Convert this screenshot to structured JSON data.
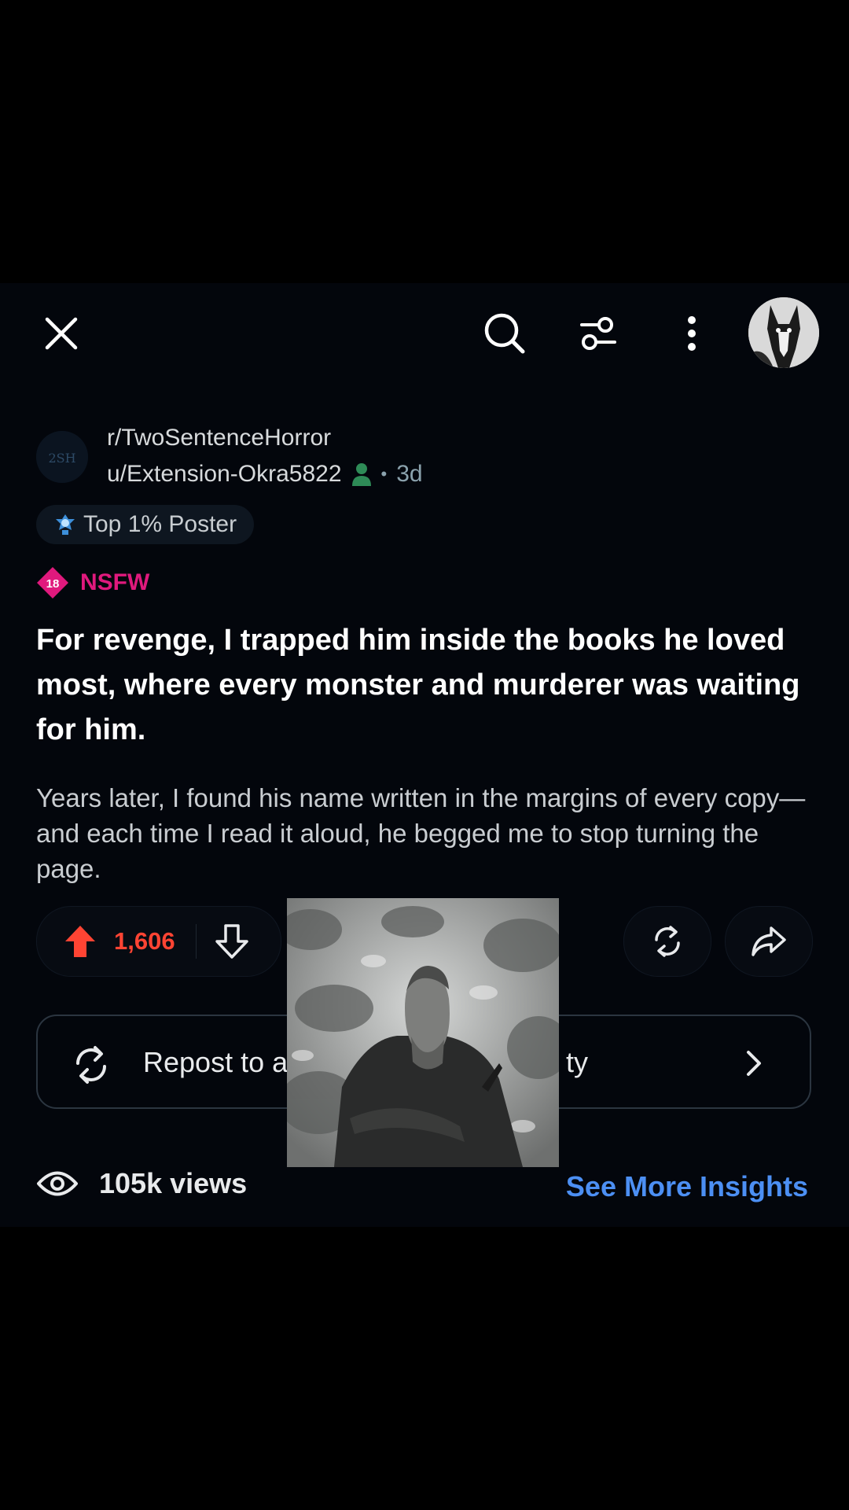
{
  "topbar": {
    "close_icon": "close-icon",
    "search_icon": "search-icon",
    "filter_icon": "filter-icon",
    "more_icon": "more-vertical-icon",
    "avatar": "user-avatar"
  },
  "post": {
    "subreddit": "r/TwoSentenceHorror",
    "subreddit_icon_text": "2SH",
    "author": "u/Extension-Okra5822",
    "separator": "•",
    "age": "3d",
    "flair": "Top 1% Poster",
    "nsfw_badge": "18",
    "nsfw_label": "NSFW",
    "title": "For revenge, I trapped him inside the books he loved most, where every monster and murderer was waiting for him.",
    "body": "Years later, I found his name written in the margins of every copy—and each time I read it aloud, he begged me to stop turning the page."
  },
  "actions": {
    "upvotes": "1,606",
    "repost_label": "Repost to a community",
    "repost_visible_start": "Repost to a",
    "repost_visible_end": "ty"
  },
  "insights": {
    "views": "105k views",
    "link": "See More Insights"
  },
  "colors": {
    "background": "#03060c",
    "upvote": "#ff4433",
    "nsfw": "#e0197d",
    "link": "#4c8ff3"
  }
}
